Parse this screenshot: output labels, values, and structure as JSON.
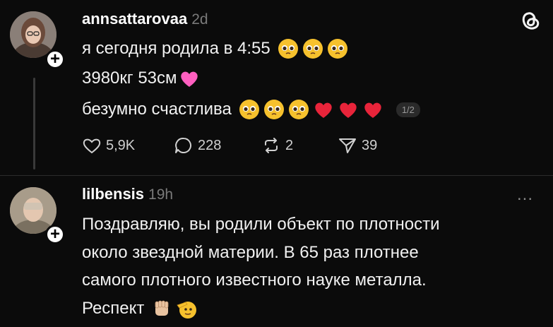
{
  "post": {
    "username": "annsattarovaa",
    "time": "2d",
    "lines": [
      "я сегодня родила в 4:55",
      "3980кг 53см",
      "безумно счастлива"
    ],
    "page_indicator": "1/2",
    "actions": {
      "likes": "5,9K",
      "comments": "228",
      "reposts": "2",
      "shares": "39"
    }
  },
  "reply": {
    "username": "lilbensis",
    "time": "19h",
    "lines": [
      "Поздравляю, вы родили объект по плотности",
      "около звездной материи. В 65 раз плотнее",
      "самого плотного известного науке металла.",
      "Респект"
    ],
    "more": "..."
  },
  "colors": {
    "background": "#0b0b0b",
    "text": "#f1f1f1",
    "muted": "#7a7a7a",
    "heart_pink": "#ff5fc0",
    "heart_red": "#e8243a",
    "emoji_yellow": "#f6c12d"
  },
  "icons": [
    "threads-logo-icon",
    "heart-icon",
    "comment-icon",
    "repost-icon",
    "share-icon",
    "more-icon",
    "plus-icon"
  ]
}
